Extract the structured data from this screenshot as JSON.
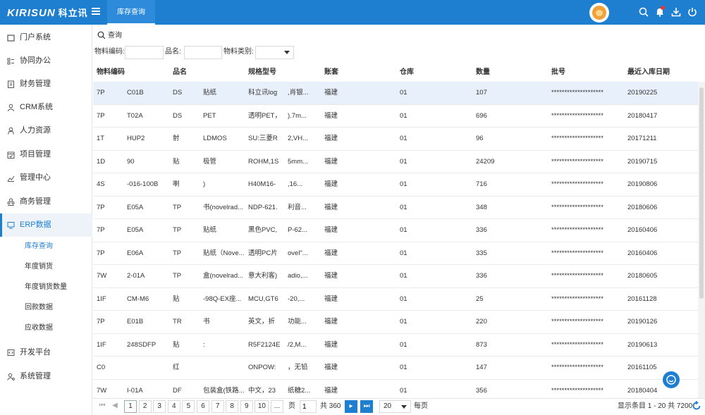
{
  "app": {
    "logo_text": "KIRISUN",
    "logo_cn": "科立讯",
    "active_tab": "库存查询"
  },
  "sidebar": {
    "items": [
      {
        "label": "门户系统"
      },
      {
        "label": "协同办公"
      },
      {
        "label": "财务管理"
      },
      {
        "label": "CRM系统"
      },
      {
        "label": "人力资源"
      },
      {
        "label": "项目管理"
      },
      {
        "label": "管理中心"
      },
      {
        "label": "商务管理"
      },
      {
        "label": "ERP数据"
      },
      {
        "label": "开发平台"
      },
      {
        "label": "系统管理"
      }
    ],
    "sub_items": [
      {
        "label": "库存查询"
      },
      {
        "label": "年度销货"
      },
      {
        "label": "年度销货数量"
      },
      {
        "label": "回款数据"
      },
      {
        "label": "应收数据"
      }
    ]
  },
  "search": {
    "button_label": "查询"
  },
  "filters": {
    "code_label": "物料编码:",
    "name_label": "品名:",
    "category_label": "物料类别:",
    "code_value": "",
    "name_value": "",
    "category_value": ""
  },
  "table": {
    "headers": [
      "物料编码",
      "品名",
      "规格型号",
      "账套",
      "仓库",
      "数量",
      "批号",
      "最近入库日期"
    ],
    "rows": [
      [
        "7P",
        "C01B",
        "DS",
        "贴纸",
        "科立讯log",
        ",肖银...",
        "福建",
        "01",
        "107",
        "********************",
        "20190225"
      ],
      [
        "7P",
        "T02A",
        "DS",
        "PET",
        "透明PET，",
        ").7m...",
        "福建",
        "01",
        "696",
        "********************",
        "20180417"
      ],
      [
        "1T",
        "HUP2",
        "射",
        "LDMOS",
        "SU:三菱R",
        "2,VH...",
        "福建",
        "01",
        "96",
        "********************",
        "20171211"
      ],
      [
        "1D",
        "90",
        "贴",
        "极管",
        "ROHM,1S",
        "5mm...",
        "福建",
        "01",
        "24209",
        "********************",
        "20190715"
      ],
      [
        "4S",
        "-016-100B",
        "喇",
        ")",
        "H40M16-",
        ",16...",
        "福建",
        "01",
        "716",
        "********************",
        "20190806"
      ],
      [
        "7P",
        "E05A",
        "TP",
        "书(novelrad...",
        "NDP-621.",
        "利音...",
        "福建",
        "01",
        "348",
        "********************",
        "20180606"
      ],
      [
        "7P",
        "E05A",
        "TP",
        "贴纸",
        "黑色PVC,",
        "P-62...",
        "福建",
        "01",
        "336",
        "********************",
        "20160406"
      ],
      [
        "7P",
        "E06A",
        "TP",
        "贴纸（Nove...",
        "透明PC片",
        "ovel\"...",
        "福建",
        "01",
        "335",
        "********************",
        "20160406"
      ],
      [
        "7W",
        "2-01A",
        "TP",
        "盒(novelrad...",
        "意大利客)",
        "adio,...",
        "福建",
        "01",
        "336",
        "********************",
        "20180605"
      ],
      [
        "1IF",
        "CM-M6",
        "贴",
        "-98Q-EX座...",
        "MCU,GT6",
        "-20,...",
        "福建",
        "01",
        "25",
        "********************",
        "20161128"
      ],
      [
        "7P",
        "E01B",
        "TR",
        "书",
        "英文，折",
        "功能...",
        "福建",
        "01",
        "220",
        "********************",
        "20190126"
      ],
      [
        "1IF",
        "248SDFP",
        "贴",
        ":",
        "R5F2124E",
        "/2,M...",
        "福建",
        "01",
        "873",
        "********************",
        "20190613"
      ],
      [
        "C0",
        "",
        "红",
        "",
        "ONPOW:",
        "，无铅",
        "福建",
        "01",
        "147",
        "********************",
        "20161105"
      ],
      [
        "7W",
        "I-01A",
        "DF",
        "包装盒(铁路...",
        "中文，23",
        "纸糖2...",
        "福建",
        "01",
        "356",
        "********************",
        "20180404"
      ]
    ]
  },
  "pagination": {
    "pages": [
      "1",
      "2",
      "3",
      "4",
      "5",
      "6",
      "7",
      "8",
      "9",
      "10",
      "..."
    ],
    "page_label": "页",
    "current_page": "1",
    "total_pages_label": "共 360",
    "page_size": "20",
    "per_page_label": "每页",
    "summary": "显示条目 1 - 20 共 7200"
  },
  "colors": {
    "primary": "#1e7fd1",
    "selected_row": "#e8f1fb",
    "badge": "#e53935"
  }
}
